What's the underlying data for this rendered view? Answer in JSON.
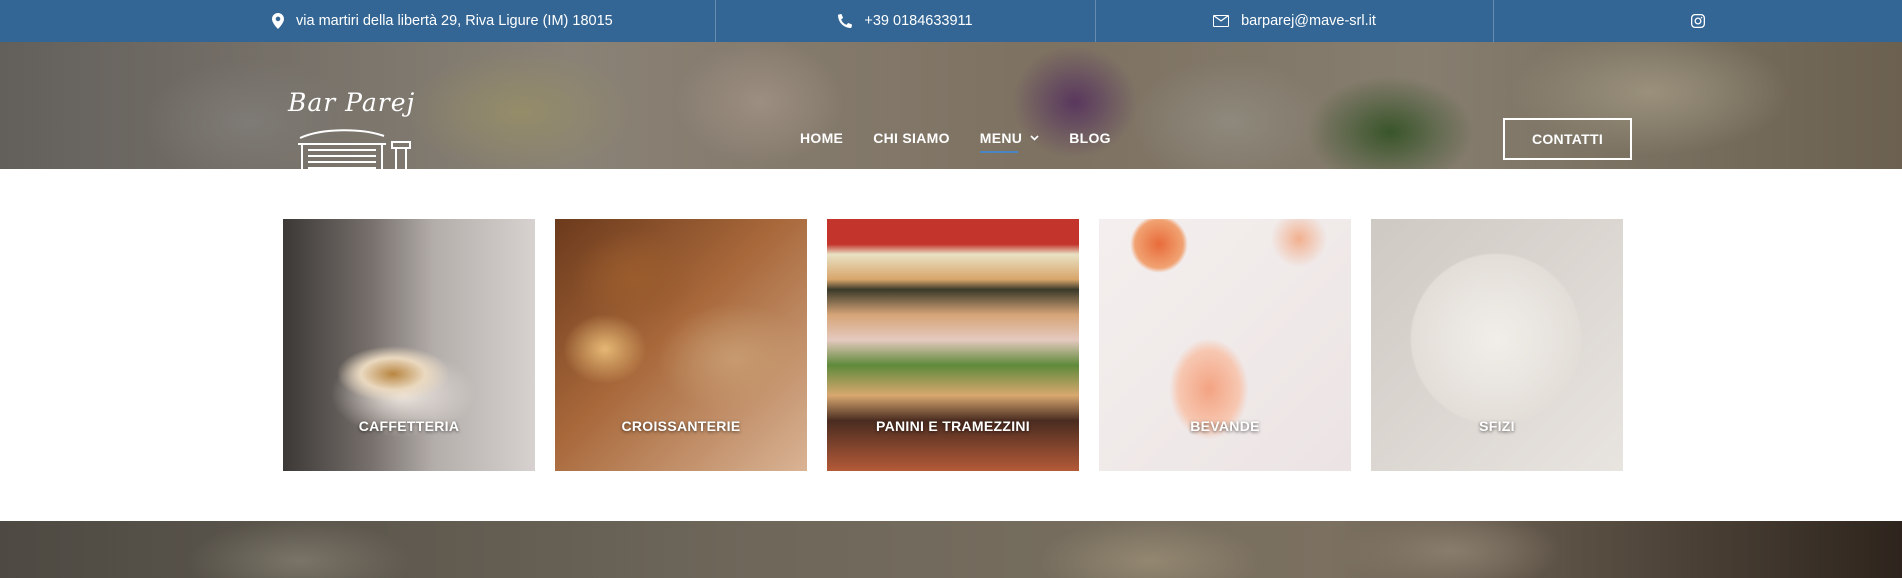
{
  "topbar": {
    "address": "via martiri della libertà 29, Riva Ligure (IM) 18015",
    "phone": "+39 0184633911",
    "email": "barparej@mave-srl.it"
  },
  "brand": {
    "name": "Bar Parej"
  },
  "nav": {
    "items": [
      {
        "label": "HOME"
      },
      {
        "label": "CHI SIAMO"
      },
      {
        "label": "MENU",
        "has_dropdown": true,
        "active": true
      },
      {
        "label": "BLOG"
      }
    ],
    "cta_label": "CONTATTI"
  },
  "categories": [
    {
      "label": "CAFFETTERIA"
    },
    {
      "label": "CROISSANTERIE"
    },
    {
      "label": "PANINI E TRAMEZZINI"
    },
    {
      "label": "BEVANDE"
    },
    {
      "label": "SFIZI"
    }
  ],
  "colors": {
    "topbar": "#336694",
    "accent": "#4a86c5"
  }
}
